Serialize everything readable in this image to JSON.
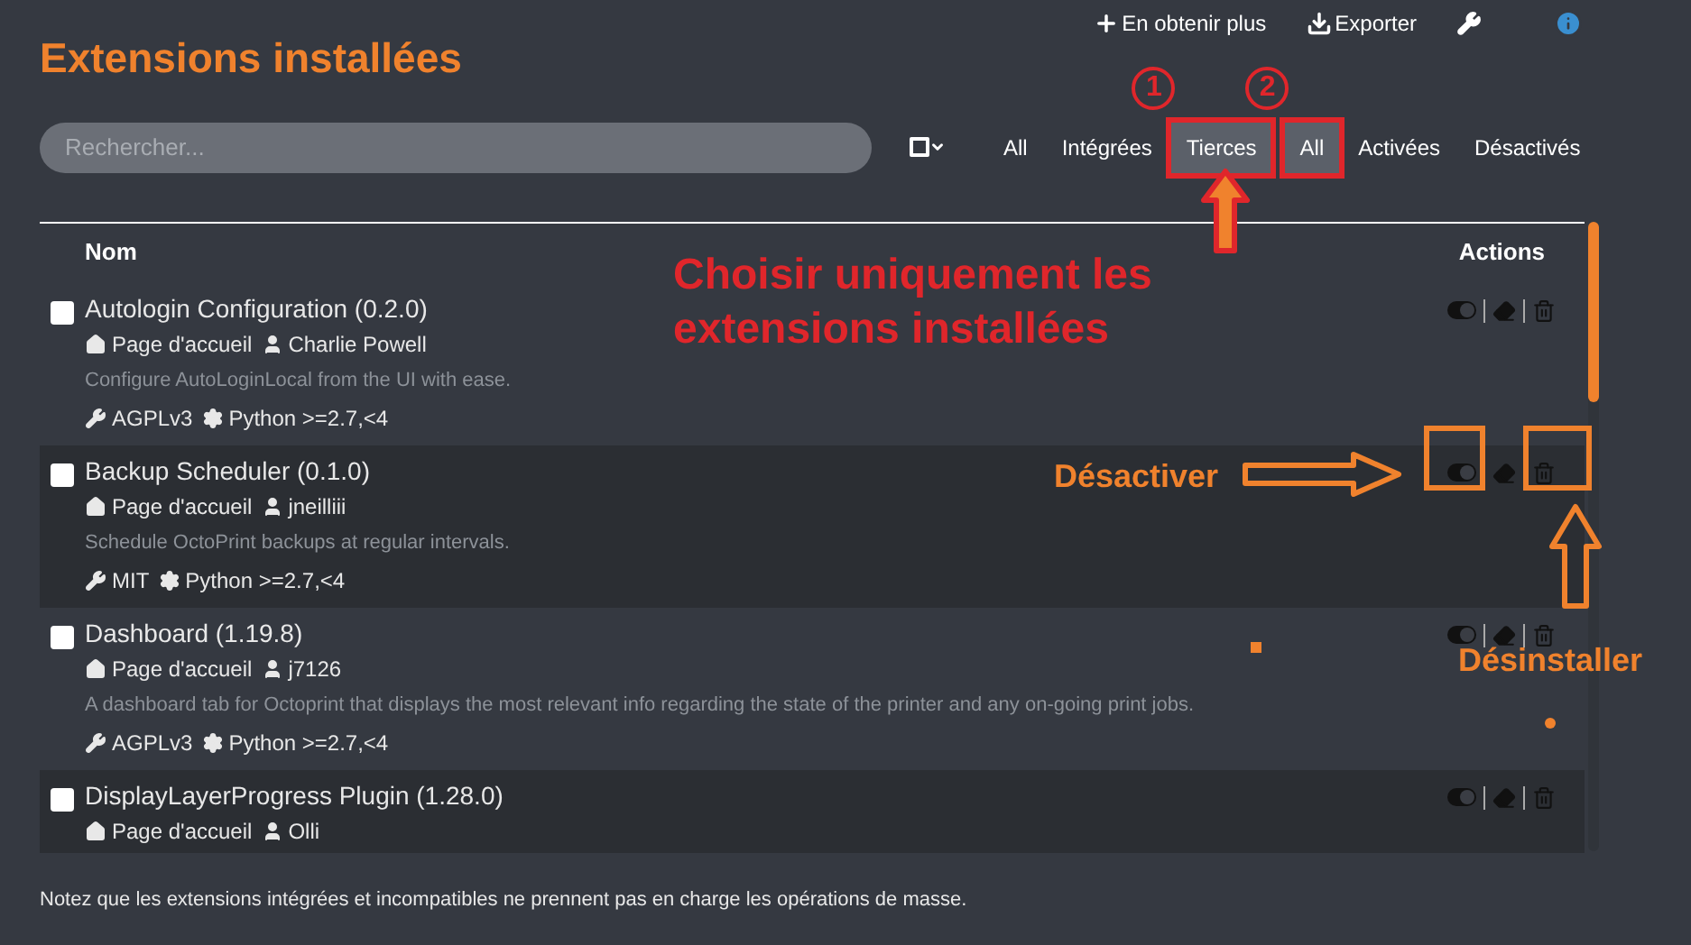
{
  "header": {
    "title": "Extensions installées",
    "links": [
      {
        "label": "En obtenir plus",
        "kind": "plus"
      },
      {
        "label": "Exporter",
        "kind": "download"
      }
    ]
  },
  "search": {
    "placeholder": "Rechercher..."
  },
  "filters": {
    "origin": [
      {
        "label": "All",
        "selected": false,
        "highlighted": false
      },
      {
        "label": "Intégrées",
        "selected": false,
        "highlighted": false
      },
      {
        "label": "Tierces",
        "selected": true,
        "highlighted": true,
        "badge": "1"
      }
    ],
    "state": [
      {
        "label": "All",
        "selected": true,
        "highlighted": true,
        "badge": "2"
      },
      {
        "label": "Activées",
        "selected": false,
        "highlighted": false
      },
      {
        "label": "Désactivés",
        "selected": false,
        "highlighted": false
      }
    ]
  },
  "table": {
    "columns": [
      "Nom",
      "Actions"
    ],
    "rows": [
      {
        "name": "Autologin Configuration (0.2.0)",
        "homepage": "Page d'accueil",
        "author": "Charlie Powell",
        "description": "Configure AutoLoginLocal from the UI with ease.",
        "license": "AGPLv3",
        "python": "Python >=2.7,<4",
        "checked": false
      },
      {
        "name": "Backup Scheduler (0.1.0)",
        "homepage": "Page d'accueil",
        "author": "jneilliii",
        "description": "Schedule OctoPrint backups at regular intervals.",
        "license": "MIT",
        "python": "Python >=2.7,<4",
        "checked": false
      },
      {
        "name": "Dashboard (1.19.8)",
        "homepage": "Page d'accueil",
        "author": "j7126",
        "description": "A dashboard tab for Octoprint that displays the most relevant info regarding the state of the printer and any on-going print jobs.",
        "license": "AGPLv3",
        "python": "Python >=2.7,<4",
        "checked": false
      },
      {
        "name": "DisplayLayerProgress Plugin (1.28.0)",
        "homepage": "Page d'accueil",
        "author": "Olli",
        "checked": false
      }
    ]
  },
  "footer_note": "Notez que les extensions intégrées et incompatibles ne prennent pas en charge les opérations de masse.",
  "annotations": {
    "instruction": "Choisir uniquement les extensions installées",
    "labels": [
      "Désactiver",
      "Désinstaller"
    ]
  }
}
